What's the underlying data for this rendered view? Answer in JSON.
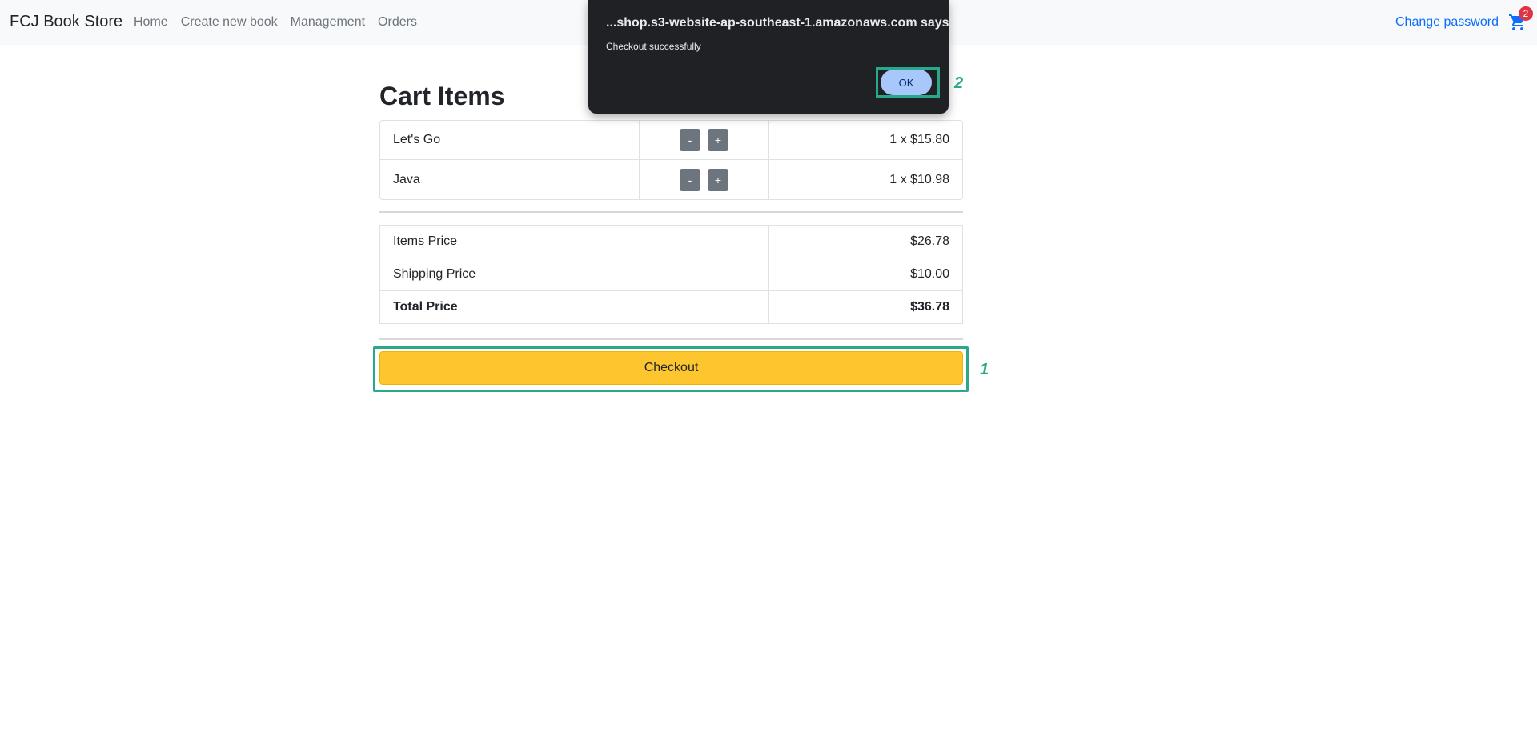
{
  "navbar": {
    "brand": "FCJ Book Store",
    "links": [
      "Home",
      "Create new book",
      "Management",
      "Orders"
    ],
    "change_password": "Change password",
    "cart_count": "2"
  },
  "cart": {
    "title": "Cart Items",
    "items": [
      {
        "name": "Let's Go",
        "minus": "-",
        "plus": "+",
        "price": "1 x $15.80"
      },
      {
        "name": "Java",
        "minus": "-",
        "plus": "+",
        "price": "1 x $10.98"
      }
    ]
  },
  "summary": {
    "items_price_label": "Items Price",
    "items_price": "$26.78",
    "shipping_label": "Shipping Price",
    "shipping": "$10.00",
    "total_label": "Total Price",
    "total": "$36.78"
  },
  "checkout_label": "Checkout",
  "annotations": {
    "checkout_marker": "1",
    "ok_marker": "2"
  },
  "dialog": {
    "title": "...shop.s3-website-ap-southeast-1.amazonaws.com says",
    "message": "Checkout successfully",
    "ok_label": "OK"
  },
  "colors": {
    "checkout_bg": "#fdc52e",
    "annotation": "#2aa88c",
    "link": "#0d6efd",
    "dialog_bg": "#202124",
    "ok_bg": "#a8c7fa"
  }
}
